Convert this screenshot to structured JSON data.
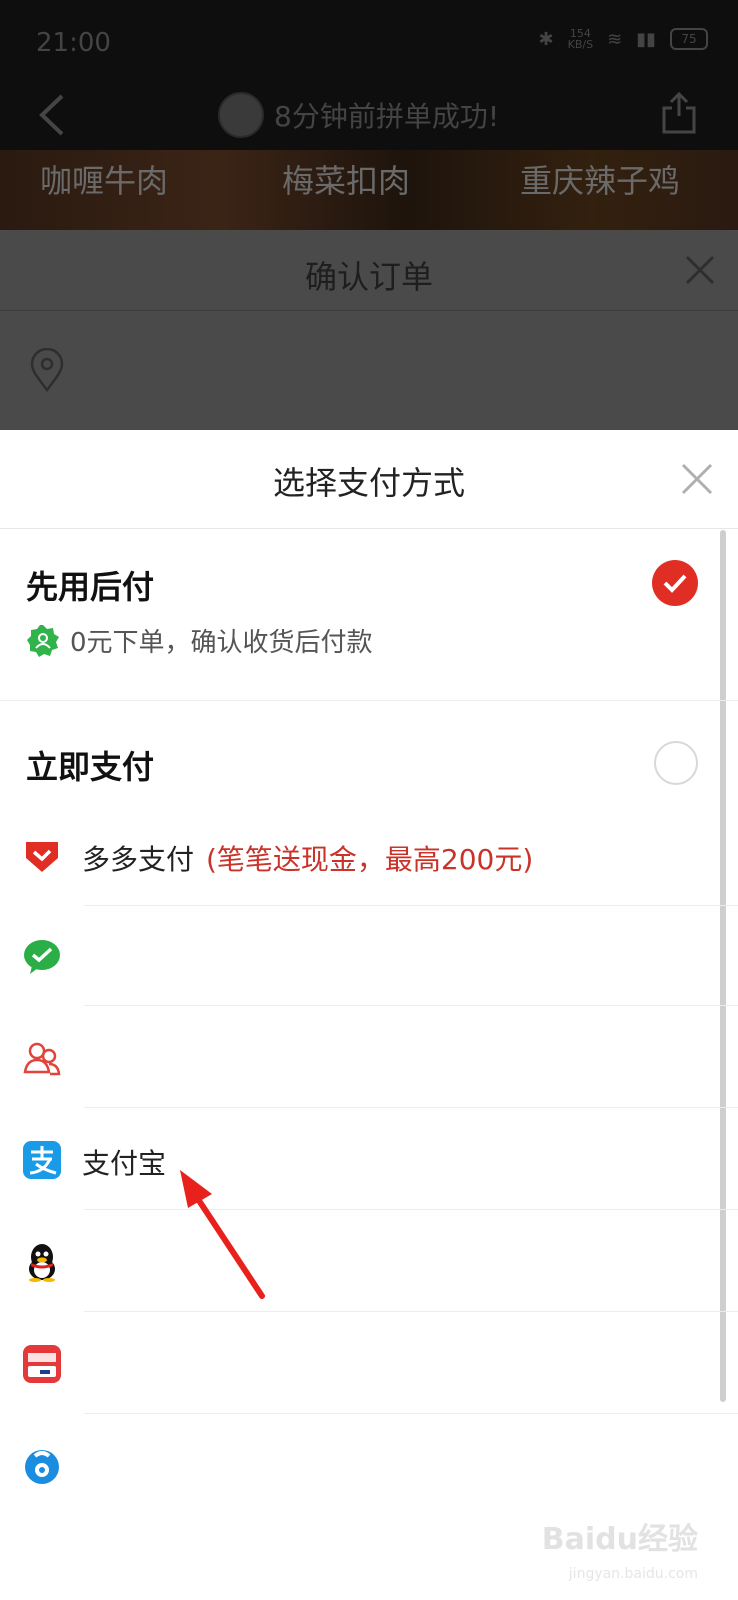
{
  "status_bar": {
    "time": "21:00",
    "net_speed": "154",
    "net_unit": "KB/S",
    "battery": "75"
  },
  "nav": {
    "title": "8分钟前拼单成功!"
  },
  "food_strip": [
    "咖喱牛肉",
    "梅菜扣肉",
    "重庆辣子鸡"
  ],
  "order_panel": {
    "title": "确认订单"
  },
  "sheet": {
    "title": "选择支付方式",
    "pay_later": {
      "title": "先用后付",
      "desc": "0元下单，确认收货后付款",
      "selected": true
    },
    "pay_now": {
      "title": "立即支付",
      "selected": false
    },
    "methods": [
      {
        "name": "多多支付",
        "promo": "(笔笔送现金，最高200元)",
        "icon": "duoduo-pay-icon"
      },
      {
        "name": "",
        "icon": "wechat-pay-icon"
      },
      {
        "name": "",
        "icon": "friend-pay-icon"
      },
      {
        "name": "支付宝",
        "icon": "alipay-icon"
      },
      {
        "name": "",
        "icon": "qq-wallet-icon"
      },
      {
        "name": "",
        "icon": "unionpay-card-icon"
      },
      {
        "name": "",
        "icon": "bank-pay-icon"
      }
    ]
  },
  "watermark": {
    "text": "Baidu经验",
    "sub": "jingyan.baidu.com"
  },
  "colors": {
    "accent": "#e02e24",
    "promo": "#c8342a",
    "dim": "#4a4a4a"
  }
}
